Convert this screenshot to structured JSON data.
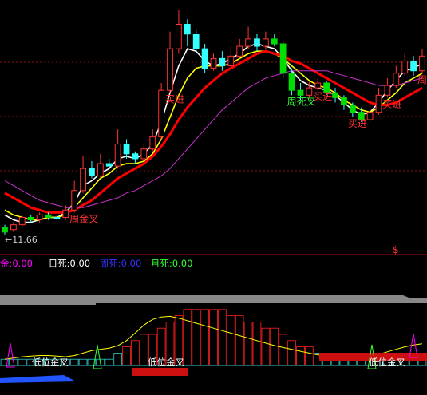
{
  "legend": {
    "items": [
      {
        "label": "金:",
        "value": "0.00",
        "color": "#ff00ff"
      },
      {
        "label": "日死:",
        "value": "0.00",
        "color": "#ffffff"
      },
      {
        "label": "周死:",
        "value": "0.00",
        "color": "#3333ff"
      },
      {
        "label": "月死:",
        "value": "0.00",
        "color": "#33ff33"
      }
    ]
  },
  "marker": "$",
  "chart_data": [
    {
      "type": "candlestick",
      "price_low_label": "←11.66",
      "annotations": [
        {
          "text": "周金叉",
          "color": "#ff3333"
        },
        {
          "text": "周死叉",
          "color": "#33ff33"
        },
        {
          "text": "买进",
          "color": "#ff3333"
        },
        {
          "text": "买进",
          "color": "#ff3333"
        },
        {
          "text": "买进",
          "color": "#ff3333"
        },
        {
          "text": "买进",
          "color": "#ff3333"
        },
        {
          "text": "周",
          "color": "#ff3333"
        }
      ],
      "candles": [
        {
          "o": 11.9,
          "c": 11.7,
          "h": 12.0,
          "l": 11.6,
          "up": false
        },
        {
          "o": 11.8,
          "c": 12.0,
          "h": 12.1,
          "l": 11.7,
          "up": true
        },
        {
          "o": 12.0,
          "c": 12.3,
          "h": 12.4,
          "l": 11.9,
          "up": true
        },
        {
          "o": 12.3,
          "c": 12.2,
          "h": 12.4,
          "l": 12.1,
          "up": false
        },
        {
          "o": 12.2,
          "c": 12.4,
          "h": 12.5,
          "l": 12.1,
          "up": true
        },
        {
          "o": 12.4,
          "c": 12.3,
          "h": 12.5,
          "l": 12.2,
          "up": false
        },
        {
          "o": 12.3,
          "c": 12.3,
          "h": 12.4,
          "l": 12.2,
          "up": false
        },
        {
          "o": 12.3,
          "c": 12.6,
          "h": 12.8,
          "l": 12.2,
          "up": true
        },
        {
          "o": 12.6,
          "c": 13.4,
          "h": 13.8,
          "l": 12.5,
          "up": true
        },
        {
          "o": 13.4,
          "c": 14.3,
          "h": 14.8,
          "l": 13.3,
          "up": true
        },
        {
          "o": 14.3,
          "c": 14.0,
          "h": 14.6,
          "l": 13.9,
          "up": false
        },
        {
          "o": 14.0,
          "c": 14.5,
          "h": 14.9,
          "l": 13.9,
          "up": true
        },
        {
          "o": 14.5,
          "c": 14.4,
          "h": 14.7,
          "l": 14.3,
          "up": false
        },
        {
          "o": 14.4,
          "c": 15.3,
          "h": 15.9,
          "l": 14.3,
          "up": true
        },
        {
          "o": 15.3,
          "c": 14.9,
          "h": 15.5,
          "l": 14.7,
          "up": false
        },
        {
          "o": 14.9,
          "c": 14.7,
          "h": 15.0,
          "l": 14.5,
          "up": false
        },
        {
          "o": 14.7,
          "c": 15.1,
          "h": 15.3,
          "l": 14.6,
          "up": true
        },
        {
          "o": 15.1,
          "c": 15.6,
          "h": 15.9,
          "l": 15.0,
          "up": true
        },
        {
          "o": 15.6,
          "c": 17.5,
          "h": 17.8,
          "l": 15.5,
          "up": true
        },
        {
          "o": 17.5,
          "c": 19.2,
          "h": 19.9,
          "l": 17.4,
          "up": true
        },
        {
          "o": 19.2,
          "c": 20.2,
          "h": 20.8,
          "l": 19.0,
          "up": true
        },
        {
          "o": 20.2,
          "c": 19.8,
          "h": 20.4,
          "l": 19.3,
          "up": false
        },
        {
          "o": 19.8,
          "c": 19.2,
          "h": 20.0,
          "l": 19.0,
          "up": false
        },
        {
          "o": 19.2,
          "c": 18.4,
          "h": 19.4,
          "l": 18.2,
          "up": false
        },
        {
          "o": 18.4,
          "c": 18.8,
          "h": 19.0,
          "l": 18.3,
          "up": true
        },
        {
          "o": 18.8,
          "c": 18.5,
          "h": 19.1,
          "l": 18.3,
          "up": false
        },
        {
          "o": 18.5,
          "c": 18.9,
          "h": 19.3,
          "l": 18.4,
          "up": true
        },
        {
          "o": 18.9,
          "c": 19.3,
          "h": 19.6,
          "l": 18.8,
          "up": true
        },
        {
          "o": 19.3,
          "c": 19.6,
          "h": 20.1,
          "l": 19.2,
          "up": true
        },
        {
          "o": 19.6,
          "c": 19.3,
          "h": 19.8,
          "l": 19.1,
          "up": false
        },
        {
          "o": 19.3,
          "c": 19.6,
          "h": 19.9,
          "l": 19.2,
          "up": true
        },
        {
          "o": 19.6,
          "c": 19.4,
          "h": 19.8,
          "l": 19.3,
          "up": false
        },
        {
          "o": 19.4,
          "c": 18.2,
          "h": 19.5,
          "l": 18.0,
          "up": false
        },
        {
          "o": 18.2,
          "c": 17.5,
          "h": 18.4,
          "l": 17.3,
          "up": false
        },
        {
          "o": 17.5,
          "c": 17.3,
          "h": 17.8,
          "l": 17.1,
          "up": false
        },
        {
          "o": 17.3,
          "c": 17.6,
          "h": 17.9,
          "l": 17.2,
          "up": true
        },
        {
          "o": 17.6,
          "c": 17.8,
          "h": 18.0,
          "l": 17.5,
          "up": true
        },
        {
          "o": 17.8,
          "c": 17.4,
          "h": 17.9,
          "l": 17.3,
          "up": false
        },
        {
          "o": 17.4,
          "c": 17.2,
          "h": 17.6,
          "l": 17.0,
          "up": false
        },
        {
          "o": 17.2,
          "c": 16.9,
          "h": 17.3,
          "l": 16.7,
          "up": false
        },
        {
          "o": 16.9,
          "c": 16.6,
          "h": 17.0,
          "l": 16.4,
          "up": false
        },
        {
          "o": 16.6,
          "c": 16.3,
          "h": 16.8,
          "l": 16.2,
          "up": false
        },
        {
          "o": 16.3,
          "c": 16.6,
          "h": 16.9,
          "l": 16.2,
          "up": true
        },
        {
          "o": 16.6,
          "c": 17.3,
          "h": 17.6,
          "l": 16.5,
          "up": true
        },
        {
          "o": 17.3,
          "c": 17.7,
          "h": 18.0,
          "l": 17.2,
          "up": true
        },
        {
          "o": 17.7,
          "c": 18.2,
          "h": 18.5,
          "l": 17.6,
          "up": true
        },
        {
          "o": 18.2,
          "c": 18.7,
          "h": 19.0,
          "l": 18.1,
          "up": true
        },
        {
          "o": 18.7,
          "c": 18.3,
          "h": 18.9,
          "l": 18.1,
          "up": false
        },
        {
          "o": 18.3,
          "c": 18.9,
          "h": 19.2,
          "l": 18.2,
          "up": true
        }
      ],
      "ma_series": [
        {
          "color": "#ffffff",
          "values": [
            12.4,
            12.2,
            12.1,
            12.1,
            12.2,
            12.3,
            12.3,
            12.5,
            12.9,
            13.6,
            13.8,
            14.1,
            14.3,
            14.7,
            14.8,
            14.7,
            14.9,
            15.3,
            16.2,
            17.4,
            18.5,
            19.2,
            19.1,
            18.7,
            18.5,
            18.6,
            18.8,
            19.0,
            19.3,
            19.4,
            19.3,
            19.2,
            18.8,
            18.3,
            17.9,
            17.7,
            17.6,
            17.5,
            17.3,
            17.0,
            16.7,
            16.5,
            16.6,
            17.0,
            17.5,
            17.9,
            18.3,
            18.4,
            18.6
          ]
        },
        {
          "color": "#ffff00",
          "values": [
            12.6,
            12.4,
            12.3,
            12.2,
            12.2,
            12.3,
            12.3,
            12.4,
            12.7,
            13.1,
            13.5,
            13.9,
            14.1,
            14.4,
            14.5,
            14.5,
            14.6,
            14.9,
            15.5,
            16.4,
            17.3,
            18.0,
            18.4,
            18.5,
            18.5,
            18.5,
            18.6,
            18.8,
            19.0,
            19.1,
            19.1,
            19.0,
            18.8,
            18.5,
            18.2,
            17.9,
            17.7,
            17.6,
            17.4,
            17.1,
            16.9,
            16.7,
            16.6,
            16.8,
            17.1,
            17.4,
            17.8,
            18.0,
            18.2
          ]
        },
        {
          "color": "#ff0000",
          "values": [
            13.3,
            13.1,
            12.9,
            12.7,
            12.6,
            12.5,
            12.5,
            12.5,
            12.6,
            12.8,
            13.0,
            13.3,
            13.6,
            13.9,
            14.1,
            14.3,
            14.5,
            14.8,
            15.2,
            15.7,
            16.3,
            16.8,
            17.2,
            17.6,
            17.9,
            18.2,
            18.4,
            18.6,
            18.8,
            19.0,
            19.1,
            19.0,
            18.9,
            18.7,
            18.6,
            18.4,
            18.2,
            18.0,
            17.8,
            17.6,
            17.4,
            17.2,
            17.0,
            16.9,
            16.9,
            17.0,
            17.2,
            17.4,
            17.6
          ]
        },
        {
          "color": "#cc33cc",
          "values": [
            13.8,
            13.6,
            13.4,
            13.2,
            13.0,
            12.9,
            12.8,
            12.7,
            12.7,
            12.7,
            12.8,
            12.9,
            13.0,
            13.1,
            13.3,
            13.4,
            13.6,
            13.8,
            14.0,
            14.3,
            14.7,
            15.1,
            15.5,
            15.9,
            16.3,
            16.7,
            17.0,
            17.3,
            17.6,
            17.8,
            18.0,
            18.1,
            18.2,
            18.3,
            18.3,
            18.3,
            18.3,
            18.3,
            18.2,
            18.1,
            18.0,
            17.9,
            17.8,
            17.7,
            17.7,
            17.7,
            17.8,
            17.9,
            18.0
          ]
        }
      ]
    },
    {
      "type": "area",
      "series_names": [
        "低位金叉",
        "低位金叉",
        "低位金叉"
      ],
      "hist": [
        1,
        1,
        1,
        1,
        1,
        1,
        1,
        1,
        1,
        1,
        1,
        1,
        1,
        2,
        3,
        4,
        5,
        5,
        6,
        7,
        8,
        9,
        9,
        9,
        9,
        9,
        8,
        8,
        7,
        7,
        6,
        6,
        5,
        4,
        3,
        3,
        2,
        2,
        1,
        1,
        1,
        1,
        1,
        1,
        1,
        1,
        1,
        1,
        1
      ],
      "line": [
        1.0,
        1.2,
        1.4,
        1.5,
        1.6,
        1.6,
        1.5,
        1.4,
        1.6,
        2.0,
        2.4,
        2.6,
        2.8,
        3.2,
        4.0,
        5.2,
        6.5,
        7.4,
        7.8,
        7.9,
        7.6,
        7.2,
        6.8,
        6.4,
        6.0,
        5.6,
        5.2,
        4.8,
        4.4,
        4.0,
        3.6,
        3.2,
        2.9,
        2.6,
        2.3,
        2.0,
        1.7,
        1.5,
        1.3,
        1.2,
        1.2,
        1.3,
        1.5,
        1.8,
        2.2,
        2.6,
        3.0,
        3.3,
        3.5
      ]
    }
  ]
}
